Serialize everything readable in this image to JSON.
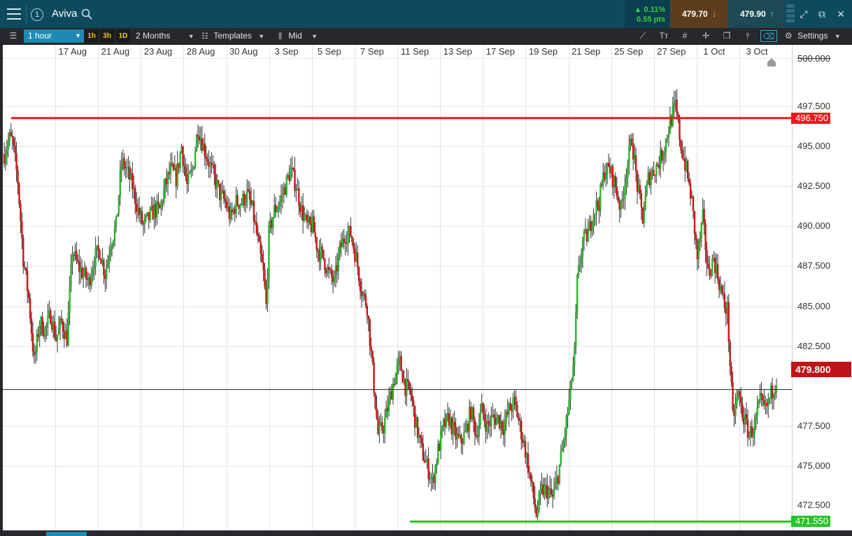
{
  "header": {
    "instrument": "Aviva",
    "window_number": "1",
    "change_pct": "▲ 0.11%",
    "change_pts": "0.55 pts",
    "sell_price": "479.70",
    "buy_price": "479.90"
  },
  "toolbar": {
    "timeframe": "1 hour",
    "quick_1": "1h",
    "quick_2": "3h",
    "quick_3": "1D",
    "period": "2 Months",
    "templates": "Templates",
    "price_mode": "Mid",
    "settings": "Settings"
  },
  "chart_data": {
    "type": "candlestick",
    "instrument": "Aviva",
    "x_tick_labels": [
      "17 Aug",
      "21 Aug",
      "23 Aug",
      "28 Aug",
      "30 Aug",
      "3 Sep",
      "5 Sep",
      "7 Sep",
      "11 Sep",
      "13 Sep",
      "17 Sep",
      "19 Sep",
      "21 Sep",
      "25 Sep",
      "27 Sep",
      "1 Oct",
      "3 Oct"
    ],
    "y_tick_labels": [
      "497.500",
      "495.000",
      "492.500",
      "490.000",
      "487.500",
      "485.000",
      "482.500",
      "477.500",
      "475.000"
    ],
    "y_top_label": "500.000",
    "y_bottom_label": "472.500",
    "ylim": [
      471.0,
      500.5
    ],
    "current_price": 479.8,
    "current_price_label": "479.800",
    "horizontal_lines": [
      {
        "value": 496.75,
        "label": "496.750",
        "color": "#e81c1c"
      },
      {
        "value": 471.55,
        "label": "471.550",
        "color": "#28c328"
      }
    ],
    "up_color": "#2db52d",
    "down_color": "#cc1414",
    "grid": true,
    "close_path": [
      [
        0,
        494.5
      ],
      [
        2,
        495.5
      ],
      [
        3,
        495.3
      ],
      [
        5,
        492.8
      ],
      [
        7,
        488.0
      ],
      [
        9,
        485.5
      ],
      [
        11,
        481.5
      ],
      [
        13,
        484.0
      ],
      [
        15,
        483.5
      ],
      [
        17,
        484.5
      ],
      [
        19,
        483.0
      ],
      [
        21,
        484.0
      ],
      [
        23,
        483.0
      ],
      [
        25,
        488.5
      ],
      [
        27,
        487.5
      ],
      [
        29,
        487.0
      ],
      [
        31,
        486.5
      ],
      [
        33,
        488.0
      ],
      [
        35,
        488.5
      ],
      [
        37,
        487.0
      ],
      [
        39,
        489.0
      ],
      [
        41,
        490.0
      ],
      [
        43,
        494.0
      ],
      [
        45,
        493.5
      ],
      [
        47,
        492.5
      ],
      [
        49,
        491.0
      ],
      [
        51,
        490.0
      ],
      [
        53,
        490.5
      ],
      [
        55,
        491.0
      ],
      [
        57,
        491.0
      ],
      [
        59,
        492.5
      ],
      [
        61,
        493.5
      ],
      [
        63,
        493.0
      ],
      [
        65,
        495.0
      ],
      [
        67,
        492.5
      ],
      [
        69,
        493.5
      ],
      [
        71,
        496.2
      ],
      [
        73,
        495.0
      ],
      [
        75,
        494.0
      ],
      [
        77,
        493.0
      ],
      [
        79,
        492.0
      ],
      [
        81,
        491.5
      ],
      [
        83,
        490.5
      ],
      [
        85,
        491.5
      ],
      [
        87,
        491.5
      ],
      [
        89,
        492.0
      ],
      [
        91,
        491.0
      ],
      [
        93,
        489.0
      ],
      [
        95,
        487.0
      ],
      [
        96,
        485.0
      ],
      [
        97,
        489.5
      ],
      [
        99,
        491.0
      ],
      [
        101,
        491.5
      ],
      [
        103,
        492.5
      ],
      [
        105,
        493.5
      ],
      [
        107,
        492.5
      ],
      [
        109,
        491.0
      ],
      [
        111,
        490.0
      ],
      [
        113,
        490.0
      ],
      [
        115,
        488.5
      ],
      [
        117,
        488.0
      ],
      [
        119,
        487.0
      ],
      [
        121,
        486.5
      ],
      [
        123,
        488.5
      ],
      [
        125,
        489.5
      ],
      [
        127,
        489.5
      ],
      [
        129,
        488.0
      ],
      [
        131,
        486.0
      ],
      [
        133,
        485.0
      ],
      [
        135,
        481.0
      ],
      [
        137,
        477.0
      ],
      [
        139,
        477.5
      ],
      [
        141,
        479.0
      ],
      [
        143,
        480.5
      ],
      [
        145,
        481.5
      ],
      [
        147,
        480.0
      ],
      [
        149,
        479.5
      ],
      [
        151,
        477.5
      ],
      [
        153,
        476.0
      ],
      [
        155,
        475.0
      ],
      [
        157,
        474.0
      ],
      [
        159,
        476.0
      ],
      [
        161,
        477.5
      ],
      [
        163,
        478.0
      ],
      [
        165,
        477.0
      ],
      [
        167,
        476.5
      ],
      [
        169,
        477.0
      ],
      [
        171,
        478.5
      ],
      [
        173,
        477.0
      ],
      [
        175,
        478.5
      ],
      [
        177,
        477.5
      ],
      [
        179,
        478.0
      ],
      [
        181,
        478.0
      ],
      [
        183,
        477.5
      ],
      [
        185,
        478.5
      ],
      [
        187,
        479.0
      ],
      [
        189,
        477.5
      ],
      [
        191,
        476.0
      ],
      [
        193,
        474.0
      ],
      [
        195,
        472.0
      ],
      [
        197,
        473.5
      ],
      [
        199,
        473.5
      ],
      [
        201,
        473.0
      ],
      [
        203,
        474.5
      ],
      [
        205,
        476.5
      ],
      [
        207,
        479.0
      ],
      [
        209,
        482.0
      ],
      [
        210,
        486.5
      ],
      [
        212,
        489.0
      ],
      [
        214,
        489.5
      ],
      [
        216,
        491.0
      ],
      [
        218,
        491.5
      ],
      [
        220,
        493.5
      ],
      [
        222,
        493.5
      ],
      [
        224,
        492.5
      ],
      [
        226,
        491.0
      ],
      [
        228,
        493.5
      ],
      [
        230,
        495.5
      ],
      [
        232,
        492.5
      ],
      [
        234,
        490.5
      ],
      [
        236,
        493.0
      ],
      [
        238,
        493.5
      ],
      [
        240,
        494.0
      ],
      [
        242,
        495.0
      ],
      [
        244,
        496.5
      ],
      [
        246,
        497.5
      ],
      [
        248,
        495.0
      ],
      [
        250,
        493.5
      ],
      [
        252,
        491.5
      ],
      [
        254,
        488.0
      ],
      [
        256,
        490.5
      ],
      [
        258,
        487.0
      ],
      [
        260,
        488.0
      ],
      [
        262,
        486.5
      ],
      [
        264,
        485.0
      ],
      [
        265,
        484.8
      ],
      [
        267,
        478.0
      ],
      [
        269,
        479.5
      ],
      [
        271,
        478.0
      ],
      [
        273,
        477.0
      ],
      [
        275,
        477.5
      ],
      [
        277,
        479.0
      ],
      [
        279,
        478.5
      ],
      [
        281,
        479.5
      ],
      [
        283,
        480.5
      ]
    ]
  }
}
